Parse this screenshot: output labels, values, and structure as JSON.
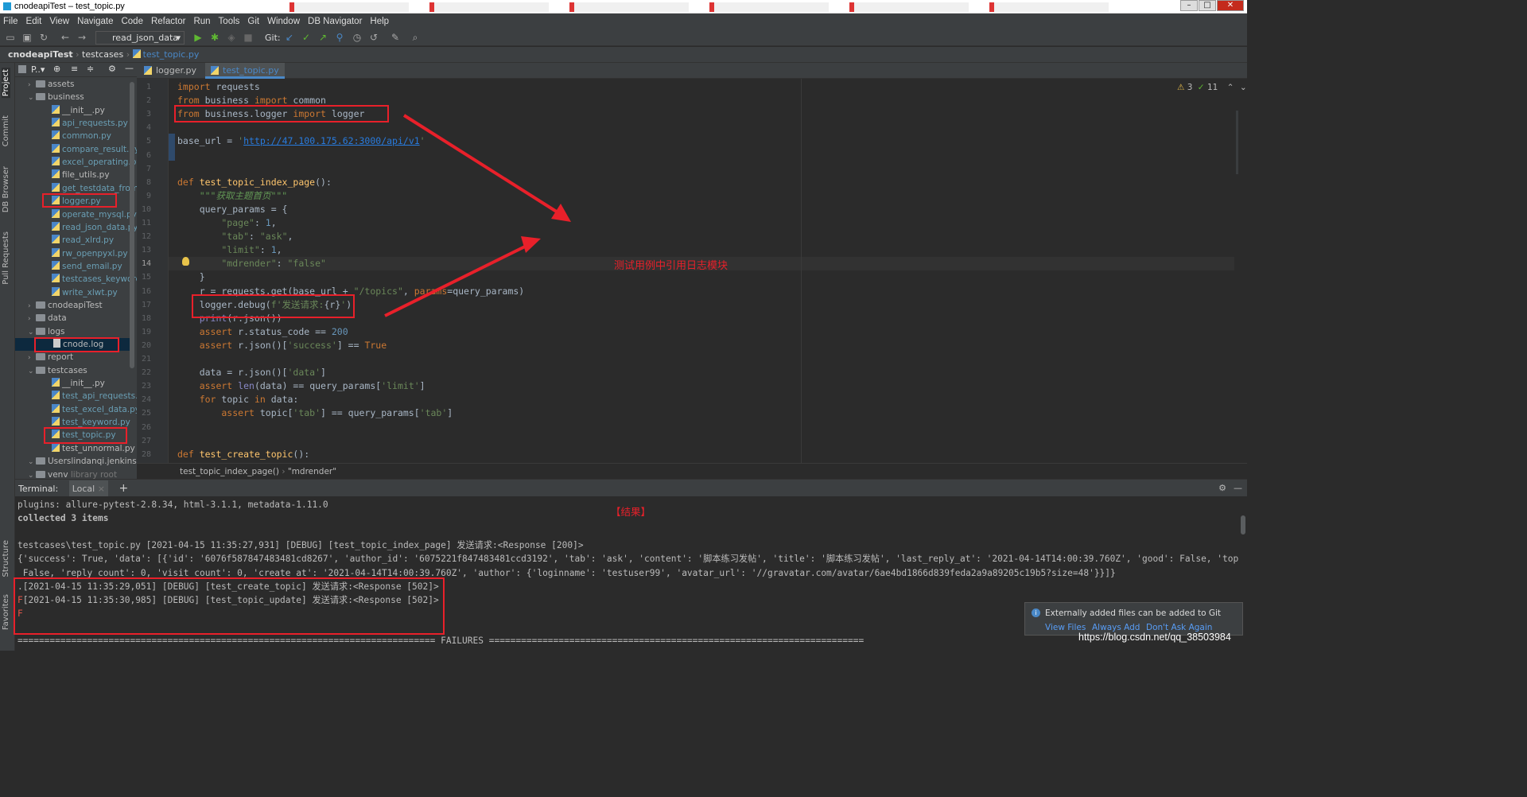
{
  "window": {
    "title": "cnodeapiTest – test_topic.py"
  },
  "menu": [
    "File",
    "Edit",
    "View",
    "Navigate",
    "Code",
    "Refactor",
    "Run",
    "Tools",
    "Git",
    "Window",
    "DB Navigator",
    "Help"
  ],
  "toolbar": {
    "run_config": "read_json_data",
    "git_label": "Git:"
  },
  "breadcrumb": [
    "cnodeapiTest",
    "testcases",
    "test_topic.py"
  ],
  "left_tools": [
    "Project",
    "Commit",
    "DB Browser",
    "Pull Requests",
    "Structure",
    "Favorites"
  ],
  "project": {
    "title": "P..▾",
    "tree": [
      {
        "label": "assets",
        "kind": "folder",
        "depth": 1,
        "arrow": "›"
      },
      {
        "label": "business",
        "kind": "folder",
        "depth": 1,
        "arrow": "⌄"
      },
      {
        "label": "__init__.py",
        "kind": "py",
        "depth": 2
      },
      {
        "label": "api_requests.py",
        "kind": "py",
        "depth": 2
      },
      {
        "label": "common.py",
        "kind": "py",
        "depth": 2
      },
      {
        "label": "compare_result.py",
        "kind": "py",
        "depth": 2
      },
      {
        "label": "excel_operating.py",
        "kind": "py",
        "depth": 2
      },
      {
        "label": "file_utils.py",
        "kind": "py",
        "depth": 2
      },
      {
        "label": "get_testdata_from",
        "kind": "py",
        "depth": 2
      },
      {
        "label": "logger.py",
        "kind": "py",
        "depth": 2
      },
      {
        "label": "operate_mysql.py",
        "kind": "py",
        "depth": 2
      },
      {
        "label": "read_json_data.py",
        "kind": "py",
        "depth": 2
      },
      {
        "label": "read_xlrd.py",
        "kind": "py",
        "depth": 2
      },
      {
        "label": "rw_openpyxl.py",
        "kind": "py",
        "depth": 2
      },
      {
        "label": "send_email.py",
        "kind": "py",
        "depth": 2
      },
      {
        "label": "testcases_keyword",
        "kind": "py",
        "depth": 2
      },
      {
        "label": "write_xlwt.py",
        "kind": "py",
        "depth": 2
      },
      {
        "label": "cnodeapiTest",
        "kind": "folder",
        "depth": 1,
        "arrow": "›"
      },
      {
        "label": "data",
        "kind": "folder",
        "depth": 1,
        "arrow": "›"
      },
      {
        "label": "logs",
        "kind": "folder",
        "depth": 1,
        "arrow": "⌄"
      },
      {
        "label": "cnode.log",
        "kind": "log",
        "depth": 2
      },
      {
        "label": "report",
        "kind": "folder",
        "depth": 1,
        "arrow": "›"
      },
      {
        "label": "testcases",
        "kind": "folder",
        "depth": 1,
        "arrow": "⌄"
      },
      {
        "label": "__init__.py",
        "kind": "py",
        "depth": 2
      },
      {
        "label": "test_api_requests.p",
        "kind": "py",
        "depth": 2
      },
      {
        "label": "test_excel_data.py",
        "kind": "py",
        "depth": 2
      },
      {
        "label": "test_keyword.py",
        "kind": "py",
        "depth": 2
      },
      {
        "label": "test_topic.py",
        "kind": "py",
        "depth": 2
      },
      {
        "label": "test_unnormal.py",
        "kind": "py",
        "depth": 2
      },
      {
        "label": "Userslindanqi.jenkinsv",
        "kind": "folder",
        "depth": 1,
        "arrow": "⌄"
      },
      {
        "label": "venv",
        "kind": "folder",
        "depth": 1,
        "arrow": "⌄",
        "suffix": " library root"
      }
    ]
  },
  "editor": {
    "tabs": [
      "logger.py",
      "test_topic.py"
    ],
    "inspections": {
      "warnings": "3",
      "ok": "11"
    },
    "line_numbers": [
      "1",
      "2",
      "3",
      "4",
      "5",
      "6",
      "7",
      "8",
      "9",
      "10",
      "11",
      "12",
      "13",
      "14",
      "15",
      "16",
      "17",
      "18",
      "19",
      "20",
      "21",
      "22",
      "23",
      "24",
      "25",
      "26",
      "27",
      "28"
    ],
    "breadcrumb": [
      "test_topic_index_page()",
      "\"mdrender\""
    ],
    "annotation": "测试用例中引用日志模块"
  },
  "code": [
    [
      [
        "kw",
        "import"
      ],
      [
        "t",
        " requests"
      ]
    ],
    [
      [
        "kw",
        "from"
      ],
      [
        "t",
        " business "
      ],
      [
        "kw",
        "import"
      ],
      [
        "t",
        " common"
      ]
    ],
    [
      [
        "kw",
        "from"
      ],
      [
        "t",
        " business.logger "
      ],
      [
        "kw",
        "import"
      ],
      [
        "t",
        " logger"
      ]
    ],
    [],
    [
      [
        "t",
        "base_url = "
      ],
      [
        "str",
        "'"
      ],
      [
        "url",
        "http://47.100.175.62:3000/api/v1"
      ],
      [
        "str",
        "'"
      ]
    ],
    [],
    [],
    [
      [
        "kw",
        "def "
      ],
      [
        "fn",
        "test_topic_index_page"
      ],
      [
        "t",
        "():"
      ]
    ],
    [
      [
        "doc",
        "    \"\"\"获取主题首页\"\"\""
      ]
    ],
    [
      [
        "t",
        "    query_params = {"
      ]
    ],
    [
      [
        "str",
        "        \"page\""
      ],
      [
        "t",
        ": "
      ],
      [
        "num",
        "1"
      ],
      [
        "t",
        ","
      ]
    ],
    [
      [
        "str",
        "        \"tab\""
      ],
      [
        "t",
        ": "
      ],
      [
        "str",
        "\"ask\""
      ],
      [
        "t",
        ","
      ]
    ],
    [
      [
        "str",
        "        \"limit\""
      ],
      [
        "t",
        ": "
      ],
      [
        "num",
        "1"
      ],
      [
        "t",
        ","
      ]
    ],
    [
      [
        "str",
        "        \"mdrender\""
      ],
      [
        "t",
        ": "
      ],
      [
        "str",
        "\"false\""
      ]
    ],
    [
      [
        "t",
        "    }"
      ]
    ],
    [
      [
        "t",
        "    r = requests.get(base_url + "
      ],
      [
        "str",
        "\"/topics\""
      ],
      [
        "t",
        ", "
      ],
      [
        "kw",
        "params"
      ],
      [
        "t",
        "=query_params)"
      ]
    ],
    [
      [
        "t",
        "    logger.debug("
      ],
      [
        "str",
        "f'发送请求:"
      ],
      [
        "t",
        "{r}"
      ],
      [
        "str",
        "'"
      ],
      [
        "t",
        ")"
      ]
    ],
    [
      [
        "bi",
        "    print"
      ],
      [
        "t",
        "(r.json())"
      ]
    ],
    [
      [
        "kw",
        "    assert"
      ],
      [
        "t",
        " r.status_code == "
      ],
      [
        "num",
        "200"
      ]
    ],
    [
      [
        "kw",
        "    assert"
      ],
      [
        "t",
        " r.json()["
      ],
      [
        "str",
        "'success'"
      ],
      [
        "t",
        "] == "
      ],
      [
        "kw",
        "True"
      ]
    ],
    [],
    [
      [
        "t",
        "    data = r.json()["
      ],
      [
        "str",
        "'data'"
      ],
      [
        "t",
        "]"
      ]
    ],
    [
      [
        "kw",
        "    assert "
      ],
      [
        "bi",
        "len"
      ],
      [
        "t",
        "(data) == query_params["
      ],
      [
        "str",
        "'limit'"
      ],
      [
        "t",
        "]"
      ]
    ],
    [
      [
        "kw",
        "    for"
      ],
      [
        "t",
        " topic "
      ],
      [
        "kw",
        "in"
      ],
      [
        "t",
        " data:"
      ]
    ],
    [
      [
        "kw",
        "        assert"
      ],
      [
        "t",
        " topic["
      ],
      [
        "str",
        "'tab'"
      ],
      [
        "t",
        "] == query_params["
      ],
      [
        "str",
        "'tab'"
      ],
      [
        "t",
        "]"
      ]
    ],
    [],
    [],
    [
      [
        "kw",
        "def "
      ],
      [
        "fn",
        "test_create_topic"
      ],
      [
        "t",
        "():"
      ]
    ]
  ],
  "terminal": {
    "tab_label": "Terminal:",
    "session": "Local",
    "result_label": "【结果】",
    "lines": [
      "plugins: allure-pytest-2.8.34, html-3.1.1, metadata-1.11.0",
      "collected 3 items",
      "",
      "testcases\\test_topic.py [2021-04-15 11:35:27,931] [DEBUG] [test_topic_index_page] 发送请求:<Response [200]>",
      "{'success': True, 'data': [{'id': '6076f587847483481cd8267', 'author_id': '6075221f847483481ccd3192', 'tab': 'ask', 'content': '脚本练习发帖', 'title': '脚本练习发帖', 'last_reply_at': '2021-04-14T14:00:39.760Z', 'good': False, 'top':",
      " False, 'reply_count': 0, 'visit_count': 0, 'create_at': '2021-04-14T14:00:39.760Z', 'author': {'loginname': 'testuser99', 'avatar_url': '//gravatar.com/avatar/6ae4bd1866d839feda2a9a89205c19b5?size=48'}}]}",
      ".[2021-04-15 11:35:29,051] [DEBUG] [test_create_topic] 发送请求:<Response [502]>",
      "F[2021-04-15 11:35:30,985] [DEBUG] [test_topic_update] 发送请求:<Response [502]>",
      "F",
      "",
      "============================================================================== FAILURES ======================================================================"
    ]
  },
  "notification": {
    "text": "Externally added files can be added to Git",
    "actions": [
      "View Files",
      "Always Add",
      "Don't Ask Again"
    ]
  },
  "watermark": "https://blog.csdn.net/qq_38503984",
  "colors": {
    "highlight": "#e8202a",
    "accent": "#4a88c7"
  }
}
